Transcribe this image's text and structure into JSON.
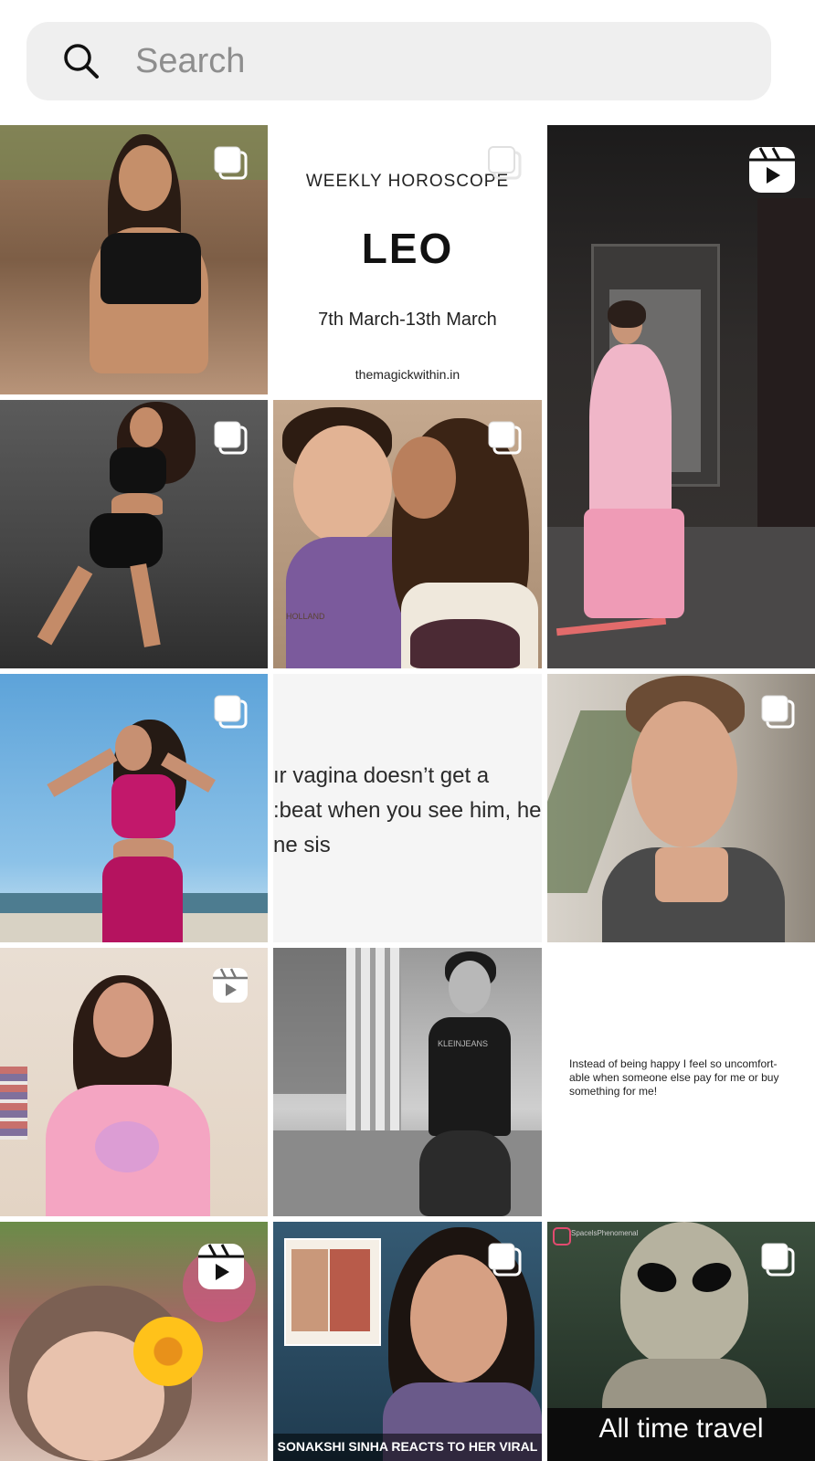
{
  "search": {
    "placeholder": "Search"
  },
  "tiles": {
    "horoscope": {
      "heading": "WEEKLY HOROSCOPE",
      "sign": "LEO",
      "dates": "7th March-13th March",
      "site": "themagickwithin.in"
    },
    "meme_text": {
      "lines": [
        "ır vagina doesn’t get a",
        ":beat when you see him, he",
        "ne sis"
      ]
    },
    "quote_text": {
      "text": "Instead of being happy I feel so uncomfort-able when someone else pay for me or buy something for me!"
    },
    "sonakshi": {
      "caption": "SONAKSHI SINHA REACTS TO HER VIRAL"
    },
    "alien": {
      "caption": "All time travel",
      "handle": "SpacelsPhenomenal"
    },
    "bw_man": {
      "shirt_text": "KLEINJEANS"
    },
    "couple": {
      "watermark": "HOLLAND"
    }
  },
  "icons": {
    "carousel": "carousel-icon",
    "reel": "reel-icon",
    "search": "search-icon"
  }
}
